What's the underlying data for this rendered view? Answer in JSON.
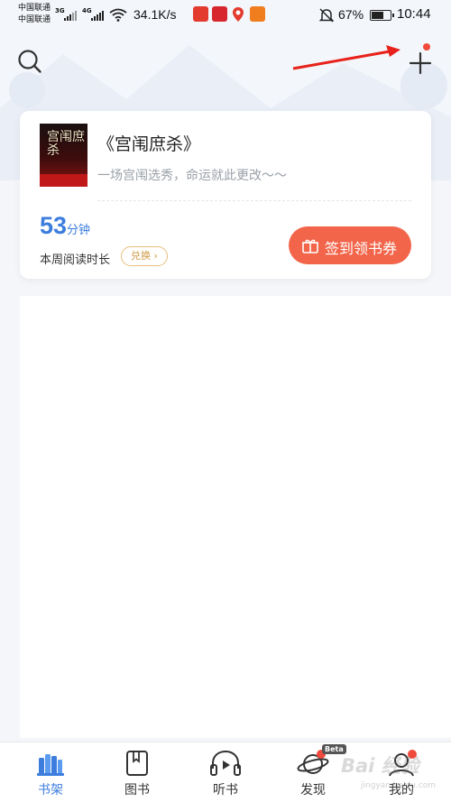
{
  "status_bar": {
    "carrier_1": "中国联通",
    "carrier_2": "中国联通",
    "net_1": "3G",
    "net_2": "4G",
    "speed": "34.1K/s",
    "battery_percent": "67%",
    "battery_level": 0.67,
    "time": "10:44",
    "icons": [
      "signal-icon",
      "wifi-icon",
      "app-notification-icon",
      "mute-bell-icon",
      "battery-icon"
    ]
  },
  "header": {
    "search_icon": "search-icon",
    "add_icon": "plus-icon",
    "annotation": "red-arrow-pointing-to-plus"
  },
  "current_book": {
    "title": "《宫闱庶杀》",
    "cover_text": "宫闱庶杀",
    "description": "一场宫闱选秀，命运就此更改～～",
    "reading_minutes": "53",
    "reading_unit": "分钟",
    "reading_label": "本周阅读时长",
    "exchange_label": "兑换",
    "sign_in_label": "签到领书券"
  },
  "tab_bar": {
    "tabs": [
      {
        "label": "书架",
        "icon": "bookshelf-icon",
        "active": true
      },
      {
        "label": "图书",
        "icon": "book-icon",
        "active": false
      },
      {
        "label": "听书",
        "icon": "headphones-icon",
        "active": false
      },
      {
        "label": "发现",
        "icon": "planet-icon",
        "active": false,
        "badge": "Beta"
      },
      {
        "label": "我的",
        "icon": "profile-icon",
        "active": false
      }
    ]
  },
  "watermark": {
    "text": "Bai 经验",
    "sub": "jingyan.baidu.com"
  },
  "colors": {
    "accent_blue": "#3c7dde",
    "sign_button": "#f2654a",
    "exchange_border": "#e8bf7c",
    "notification_dot": "#f04a3c"
  }
}
